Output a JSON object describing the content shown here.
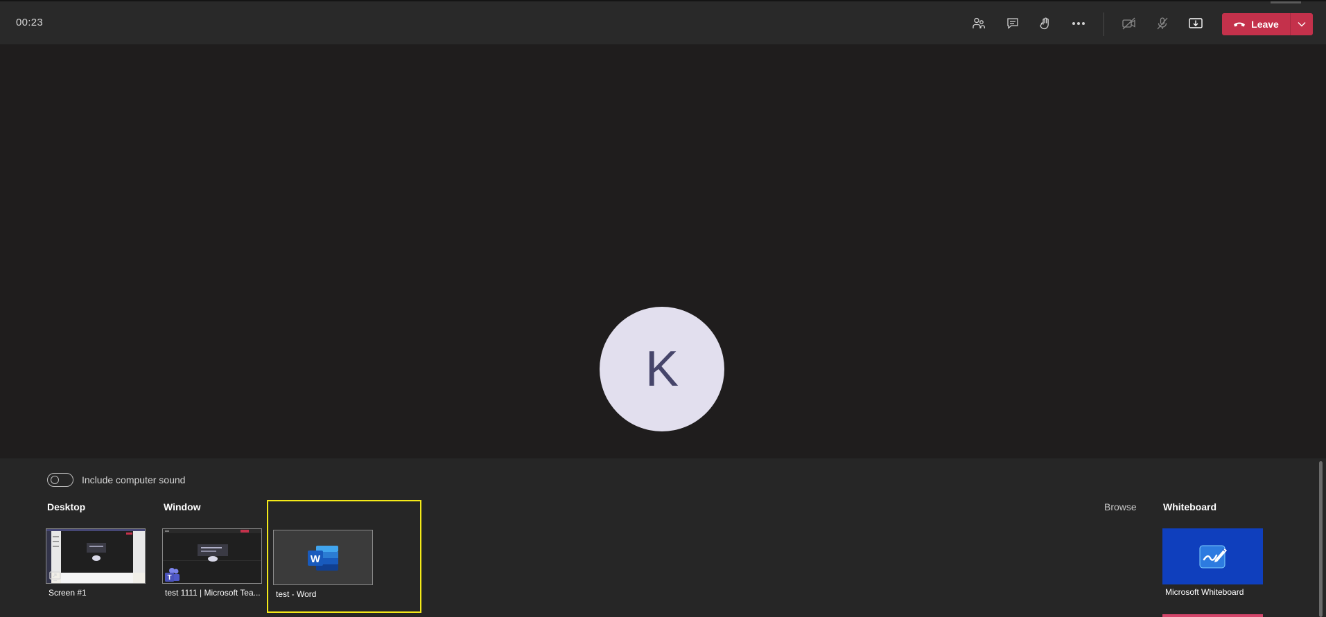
{
  "toolbar": {
    "timer": "00:23",
    "leave_label": "Leave",
    "buttons": [
      {
        "name": "participants",
        "icon": "people-icon"
      },
      {
        "name": "chat",
        "icon": "chat-icon"
      },
      {
        "name": "raise-hand",
        "icon": "hand-icon"
      },
      {
        "name": "more-actions",
        "icon": "more-icon"
      },
      {
        "name": "camera-off",
        "icon": "camera-off-icon"
      },
      {
        "name": "mic-off",
        "icon": "mic-off-icon"
      },
      {
        "name": "share",
        "icon": "share-tray-icon"
      }
    ],
    "leave_color": "#c4314b"
  },
  "stage": {
    "avatar_initial": "K"
  },
  "share_tray": {
    "include_sound_label": "Include computer sound",
    "include_sound_on": false,
    "desktop_title": "Desktop",
    "window_title": "Window",
    "browse_label": "Browse",
    "whiteboard_title": "Whiteboard",
    "desktop_items": [
      {
        "label": "Screen #1"
      }
    ],
    "window_items": [
      {
        "label": "test 1111 | Microsoft Tea..."
      },
      {
        "label": "test - Word",
        "selected": true
      }
    ],
    "whiteboard_items": [
      {
        "label": "Microsoft Whiteboard"
      }
    ],
    "selected_color": "#f4ea18"
  }
}
